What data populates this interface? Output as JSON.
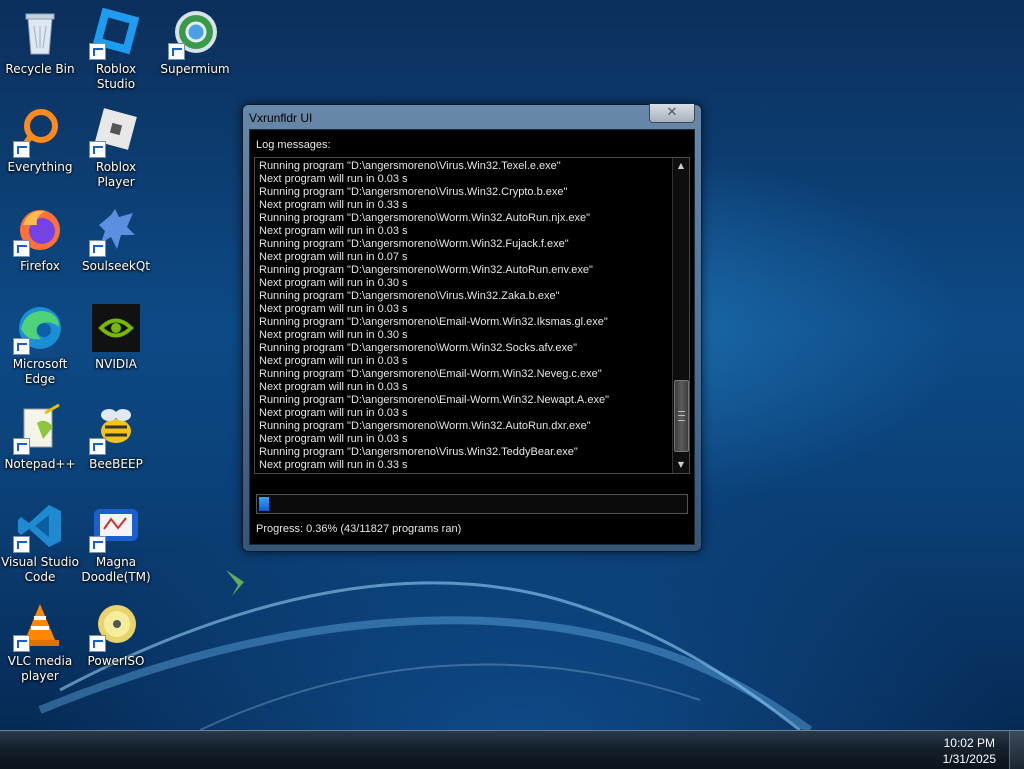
{
  "desktop_icons": [
    {
      "label": "Recycle Bin",
      "icon": "recycle-bin-icon"
    },
    {
      "label": "Roblox Studio",
      "icon": "roblox-studio-icon"
    },
    {
      "label": "Supermium",
      "icon": "supermium-icon"
    },
    {
      "label": "Everything",
      "icon": "everything-icon"
    },
    {
      "label": "Roblox Player",
      "icon": "roblox-player-icon"
    },
    {
      "label": "Firefox",
      "icon": "firefox-icon"
    },
    {
      "label": "SoulseekQt",
      "icon": "soulseekqt-icon"
    },
    {
      "label": "Microsoft Edge",
      "icon": "edge-icon"
    },
    {
      "label": "NVIDIA",
      "icon": "nvidia-icon"
    },
    {
      "label": "Notepad++",
      "icon": "notepadpp-icon"
    },
    {
      "label": "BeeBEEP",
      "icon": "beebeep-icon"
    },
    {
      "label": "Visual Studio Code",
      "icon": "vscode-icon"
    },
    {
      "label": "Magna Doodle(TM)",
      "icon": "magna-doodle-icon"
    },
    {
      "label": "VLC media player",
      "icon": "vlc-icon"
    },
    {
      "label": "PowerISO",
      "icon": "poweriso-icon"
    }
  ],
  "window": {
    "title": "Vxrunfldr UI",
    "close_symbol": "✕",
    "log_label": "Log messages:",
    "log_lines": [
      "Running program \"D:\\angersmoreno\\Virus.Win32.Texel.e.exe\"",
      "Next program will run in 0.03 s",
      "Running program \"D:\\angersmoreno\\Virus.Win32.Crypto.b.exe\"",
      "Next program will run in 0.33 s",
      "Running program \"D:\\angersmoreno\\Worm.Win32.AutoRun.njx.exe\"",
      "Next program will run in 0.03 s",
      "Running program \"D:\\angersmoreno\\Worm.Win32.Fujack.f.exe\"",
      "Next program will run in 0.07 s",
      "Running program \"D:\\angersmoreno\\Worm.Win32.AutoRun.env.exe\"",
      "Next program will run in 0.30 s",
      "Running program \"D:\\angersmoreno\\Virus.Win32.Zaka.b.exe\"",
      "Next program will run in 0.03 s",
      "Running program \"D:\\angersmoreno\\Email-Worm.Win32.Iksmas.gl.exe\"",
      "Next program will run in 0.30 s",
      "Running program \"D:\\angersmoreno\\Worm.Win32.Socks.afv.exe\"",
      "Next program will run in 0.03 s",
      "Running program \"D:\\angersmoreno\\Email-Worm.Win32.Neveg.c.exe\"",
      "Next program will run in 0.03 s",
      "Running program \"D:\\angersmoreno\\Email-Worm.Win32.Newapt.A.exe\"",
      "Next program will run in 0.03 s",
      "Running program \"D:\\angersmoreno\\Worm.Win32.AutoRun.dxr.exe\"",
      "Next program will run in 0.03 s",
      "Running program \"D:\\angersmoreno\\Virus.Win32.TeddyBear.exe\"",
      "Next program will run in 0.33 s"
    ],
    "progress_fraction": 0.0036,
    "progress_text": "Progress: 0.36% (43/11827 programs ran)"
  },
  "taskbar": {
    "time": "10:02 PM",
    "date": "1/31/2025"
  },
  "colors": {
    "progress_fill": "#0a5fd6",
    "window_client": "#000000"
  }
}
